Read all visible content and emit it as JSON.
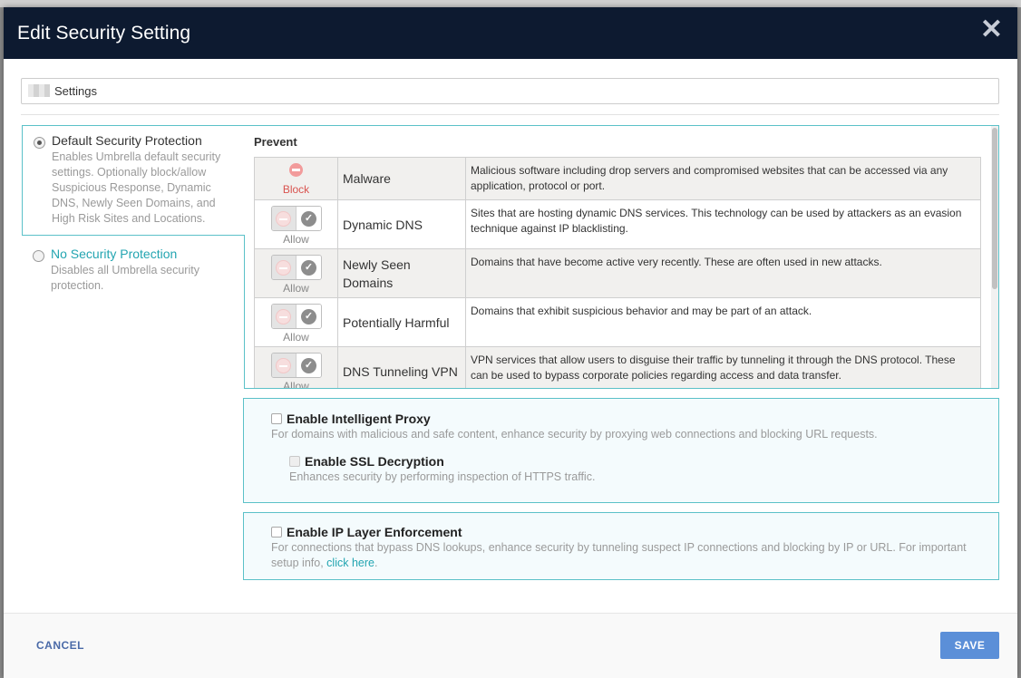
{
  "modal": {
    "title": "Edit Security Setting",
    "close_glyph": "✕"
  },
  "name_field": {
    "value": "Settings"
  },
  "options": {
    "default": {
      "title": "Default Security Protection",
      "description": "Enables Umbrella default security settings. Optionally block/allow Suspicious Response, Dynamic DNS, Newly Seen Domains, and High Risk Sites and Locations.",
      "selected": true
    },
    "none": {
      "title": "No Security Protection",
      "description": "Disables all Umbrella security protection.",
      "selected": false
    }
  },
  "prevent": {
    "heading": "Prevent",
    "rows": [
      {
        "action": "Block",
        "name": "Malware",
        "description": "Malicious software including drop servers and compromised websites that can be accessed via any application, protocol or port."
      },
      {
        "action": "Allow",
        "name": "Dynamic DNS",
        "description": "Sites that are hosting dynamic DNS services. This technology can be used by attackers as an evasion technique against IP blacklisting."
      },
      {
        "action": "Allow",
        "name": "Newly Seen Domains",
        "description": "Domains that have become active very recently. These are often used in new attacks."
      },
      {
        "action": "Allow",
        "name": "Potentially Harmful",
        "description": "Domains that exhibit suspicious behavior and may be part of an attack."
      },
      {
        "action": "Allow",
        "name": "DNS Tunneling VPN",
        "description": "VPN services that allow users to disguise their traffic by tunneling it through the DNS protocol. These can be used to bypass corporate policies regarding access and data transfer."
      }
    ]
  },
  "intelligent_proxy": {
    "label": "Enable Intelligent Proxy",
    "description": "For domains with malicious and safe content, enhance security by proxying web connections and blocking URL requests.",
    "ssl_label": "Enable SSL Decryption",
    "ssl_description": "Enhances security by performing inspection of HTTPS traffic."
  },
  "ip_layer": {
    "label": "Enable IP Layer Enforcement",
    "description": "For connections that bypass DNS lookups, enhance security by tunneling suspect IP connections and blocking by IP or URL. For important setup info,",
    "link_text": "click here"
  },
  "footer": {
    "cancel_label": "CANCEL",
    "save_label": "SAVE"
  },
  "colors": {
    "header_bg": "#0d1a30",
    "accent_teal": "#5bc1c8",
    "block_red": "#d9534f",
    "save_blue": "#5b8fd8"
  }
}
